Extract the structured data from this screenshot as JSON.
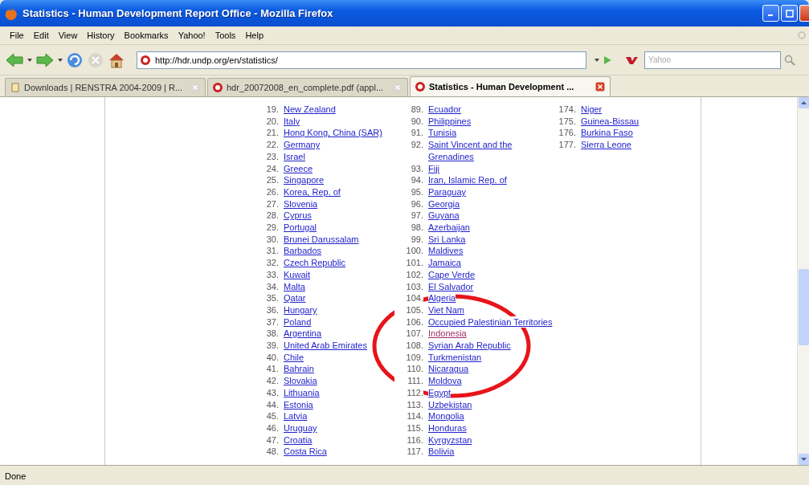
{
  "window": {
    "title": "Statistics - Human Development Report Office - Mozilla Firefox"
  },
  "menu": [
    "File",
    "Edit",
    "View",
    "History",
    "Bookmarks",
    "Yahoo!",
    "Tools",
    "Help"
  ],
  "navigation": {
    "url": "http://hdr.undp.org/en/statistics/"
  },
  "search": {
    "placeholder": "Yahoo"
  },
  "tabs": [
    {
      "label": "Downloads | RENSTRA 2004-2009 | R...",
      "selected": false,
      "kind": "page"
    },
    {
      "label": "hdr_20072008_en_complete.pdf (appl...",
      "selected": false,
      "kind": "pdf"
    },
    {
      "label": "Statistics - Human Development ...",
      "selected": true,
      "kind": "pdf"
    }
  ],
  "page": {
    "columns": [
      [
        {
          "rank": "19.",
          "name": "New Zealand",
          "visited": false
        },
        {
          "rank": "20.",
          "name": "Italy",
          "visited": false
        },
        {
          "rank": "21.",
          "name": "Hong Kong, China (SAR)",
          "visited": false
        },
        {
          "rank": "22.",
          "name": "Germany",
          "visited": false
        },
        {
          "rank": "23.",
          "name": "Israel",
          "visited": false
        },
        {
          "rank": "24.",
          "name": "Greece",
          "visited": false
        },
        {
          "rank": "25.",
          "name": "Singapore",
          "visited": false
        },
        {
          "rank": "26.",
          "name": "Korea, Rep. of",
          "visited": false
        },
        {
          "rank": "27.",
          "name": "Slovenia",
          "visited": false
        },
        {
          "rank": "28.",
          "name": "Cyprus",
          "visited": false
        },
        {
          "rank": "29.",
          "name": "Portugal",
          "visited": false
        },
        {
          "rank": "30.",
          "name": "Brunei Darussalam",
          "visited": false
        },
        {
          "rank": "31.",
          "name": "Barbados",
          "visited": false
        },
        {
          "rank": "32.",
          "name": "Czech Republic",
          "visited": false
        },
        {
          "rank": "33.",
          "name": "Kuwait",
          "visited": false
        },
        {
          "rank": "34.",
          "name": "Malta",
          "visited": false
        },
        {
          "rank": "35.",
          "name": "Qatar",
          "visited": false
        },
        {
          "rank": "36.",
          "name": "Hungary",
          "visited": false
        },
        {
          "rank": "37.",
          "name": "Poland",
          "visited": false
        },
        {
          "rank": "38.",
          "name": "Argentina",
          "visited": false
        },
        {
          "rank": "39.",
          "name": "United Arab Emirates",
          "visited": false
        },
        {
          "rank": "40.",
          "name": "Chile",
          "visited": false
        },
        {
          "rank": "41.",
          "name": "Bahrain",
          "visited": false
        },
        {
          "rank": "42.",
          "name": "Slovakia",
          "visited": false
        },
        {
          "rank": "43.",
          "name": "Lithuania",
          "visited": false
        },
        {
          "rank": "44.",
          "name": "Estonia",
          "visited": false
        },
        {
          "rank": "45.",
          "name": "Latvia",
          "visited": false
        },
        {
          "rank": "46.",
          "name": "Uruguay",
          "visited": false
        },
        {
          "rank": "47.",
          "name": "Croatia",
          "visited": false
        },
        {
          "rank": "48.",
          "name": "Costa Rica",
          "visited": false
        }
      ],
      [
        {
          "rank": "89.",
          "name": "Ecuador",
          "visited": false
        },
        {
          "rank": "90.",
          "name": "Philippines",
          "visited": false
        },
        {
          "rank": "91.",
          "name": "Tunisia",
          "visited": false
        },
        {
          "rank": "92.",
          "name": "Saint Vincent and the\nGrenadines",
          "visited": false
        },
        {
          "rank": "93.",
          "name": "Fiji",
          "visited": false
        },
        {
          "rank": "94.",
          "name": "Iran, Islamic Rep. of",
          "visited": false
        },
        {
          "rank": "95.",
          "name": "Paraguay",
          "visited": false
        },
        {
          "rank": "96.",
          "name": "Georgia",
          "visited": false
        },
        {
          "rank": "97.",
          "name": "Guyana",
          "visited": false
        },
        {
          "rank": "98.",
          "name": "Azerbaijan",
          "visited": false
        },
        {
          "rank": "99.",
          "name": "Sri Lanka",
          "visited": false
        },
        {
          "rank": "100.",
          "name": "Maldives",
          "visited": false
        },
        {
          "rank": "101.",
          "name": "Jamaica",
          "visited": false
        },
        {
          "rank": "102.",
          "name": "Cape Verde",
          "visited": false
        },
        {
          "rank": "103.",
          "name": "El Salvador",
          "visited": false
        },
        {
          "rank": "104.",
          "name": "Algeria",
          "visited": false
        },
        {
          "rank": "105.",
          "name": "Viet Nam",
          "visited": false
        },
        {
          "rank": "106.",
          "name": "Occupied Palestinian Territories",
          "visited": false
        },
        {
          "rank": "107.",
          "name": "Indonesia",
          "visited": true
        },
        {
          "rank": "108.",
          "name": "Syrian Arab Republic",
          "visited": false
        },
        {
          "rank": "109.",
          "name": "Turkmenistan",
          "visited": false
        },
        {
          "rank": "110.",
          "name": "Nicaragua",
          "visited": false
        },
        {
          "rank": "111.",
          "name": "Moldova",
          "visited": false
        },
        {
          "rank": "112.",
          "name": "Egypt",
          "visited": false
        },
        {
          "rank": "113.",
          "name": "Uzbekistan",
          "visited": false
        },
        {
          "rank": "114.",
          "name": "Mongolia",
          "visited": false
        },
        {
          "rank": "115.",
          "name": "Honduras",
          "visited": false
        },
        {
          "rank": "116.",
          "name": "Kyrgyzstan",
          "visited": false
        },
        {
          "rank": "117.",
          "name": "Bolivia",
          "visited": false
        }
      ],
      [
        {
          "rank": "174.",
          "name": "Niger",
          "visited": false
        },
        {
          "rank": "175.",
          "name": "Guinea-Bissau",
          "visited": false
        },
        {
          "rank": "176.",
          "name": "Burkina Faso",
          "visited": false
        },
        {
          "rank": "177.",
          "name": "Sierra Leone",
          "visited": false
        }
      ]
    ]
  },
  "status_bar": {
    "text": "Done"
  }
}
